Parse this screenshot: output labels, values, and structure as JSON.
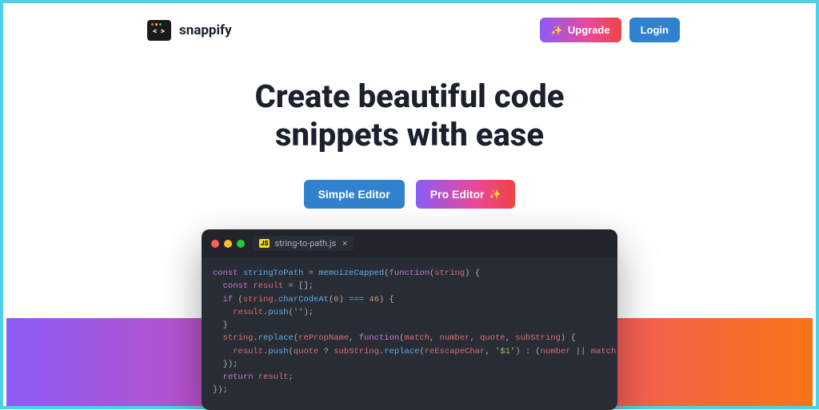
{
  "header": {
    "brand": "snappify",
    "upgrade_label": "Upgrade",
    "login_label": "Login"
  },
  "hero": {
    "title_line1": "Create beautiful code",
    "title_line2": "snippets with ease"
  },
  "cta": {
    "simple_label": "Simple Editor",
    "pro_label": "Pro Editor"
  },
  "code_window": {
    "tab": {
      "lang_badge": "JS",
      "filename": "string-to-path.js",
      "close": "×"
    },
    "code": {
      "l1_kw1": "const",
      "l1_var": "stringToPath",
      "l1_eq": " = ",
      "l1_fn1": "memoizeCapped",
      "l1_p1": "(",
      "l1_kw2": "function",
      "l1_p2": "(",
      "l1_arg": "string",
      "l1_p3": ") {",
      "l2_indent": "  ",
      "l2_kw": "const",
      "l2_var": "result",
      "l2_rest": " = [];",
      "l3_indent": "  ",
      "l3_kw": "if",
      "l3_p1": " (",
      "l3_obj": "string",
      "l3_dot": ".",
      "l3_fn": "charCodeAt",
      "l3_p2": "(",
      "l3_num1": "0",
      "l3_p3": ") ",
      "l3_op": "===",
      "l3_sp": " ",
      "l3_num2": "46",
      "l3_p4": ") {",
      "l4_indent": "    ",
      "l4_obj": "result",
      "l4_dot": ".",
      "l4_fn": "push",
      "l4_p1": "(",
      "l4_str": "''",
      "l4_p2": ");",
      "l5": "  }",
      "l6_indent": "  ",
      "l6_obj": "string",
      "l6_dot": ".",
      "l6_fn": "replace",
      "l6_p1": "(",
      "l6_a1": "rePropName",
      "l6_c1": ", ",
      "l6_kw": "function",
      "l6_p2": "(",
      "l6_a2": "match",
      "l6_c2": ", ",
      "l6_a3": "number",
      "l6_c3": ", ",
      "l6_a4": "quote",
      "l6_c4": ", ",
      "l6_a5": "subString",
      "l6_p3": ") {",
      "l7_indent": "    ",
      "l7_obj": "result",
      "l7_dot": ".",
      "l7_fn": "push",
      "l7_p1": "(",
      "l7_a1": "quote",
      "l7_q": " ? ",
      "l7_a2": "subString",
      "l7_dot2": ".",
      "l7_fn2": "replace",
      "l7_p2": "(",
      "l7_a3": "reEscapeChar",
      "l7_c1": ", ",
      "l7_str": "'$1'",
      "l7_p3": ")",
      "l7_col": " : ",
      "l7_p4": "(",
      "l7_a4": "number",
      "l7_or": " || ",
      "l7_a5": "match",
      "l7_p5": "));",
      "l8": "  });",
      "l9_indent": "  ",
      "l9_kw": "return",
      "l9_sp": " ",
      "l9_var": "result",
      "l9_semi": ";",
      "l10": "});"
    }
  }
}
